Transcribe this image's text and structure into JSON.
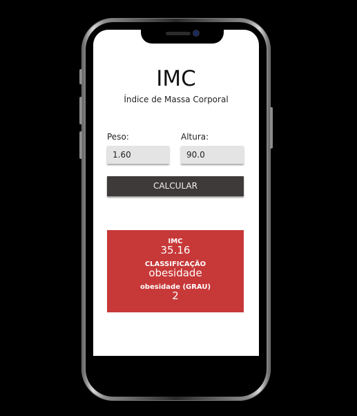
{
  "app": {
    "title": "IMC",
    "subtitle": "Índice de Massa Corporal"
  },
  "form": {
    "peso_label": "Peso:",
    "peso_value": "1.60",
    "altura_label": "Altura:",
    "altura_value": "90.0",
    "calculate_label": "CALCULAR"
  },
  "result": {
    "imc_label": "IMC",
    "imc_value": "35.16",
    "class_label": "CLASSIFICAÇÃO",
    "class_value": "obesidade",
    "grade_label": "obesidade (GRAU)",
    "grade_value": "2",
    "color": "#c73838"
  },
  "icons": {
    "camera": "camera-icon",
    "speaker": "speaker-icon"
  }
}
